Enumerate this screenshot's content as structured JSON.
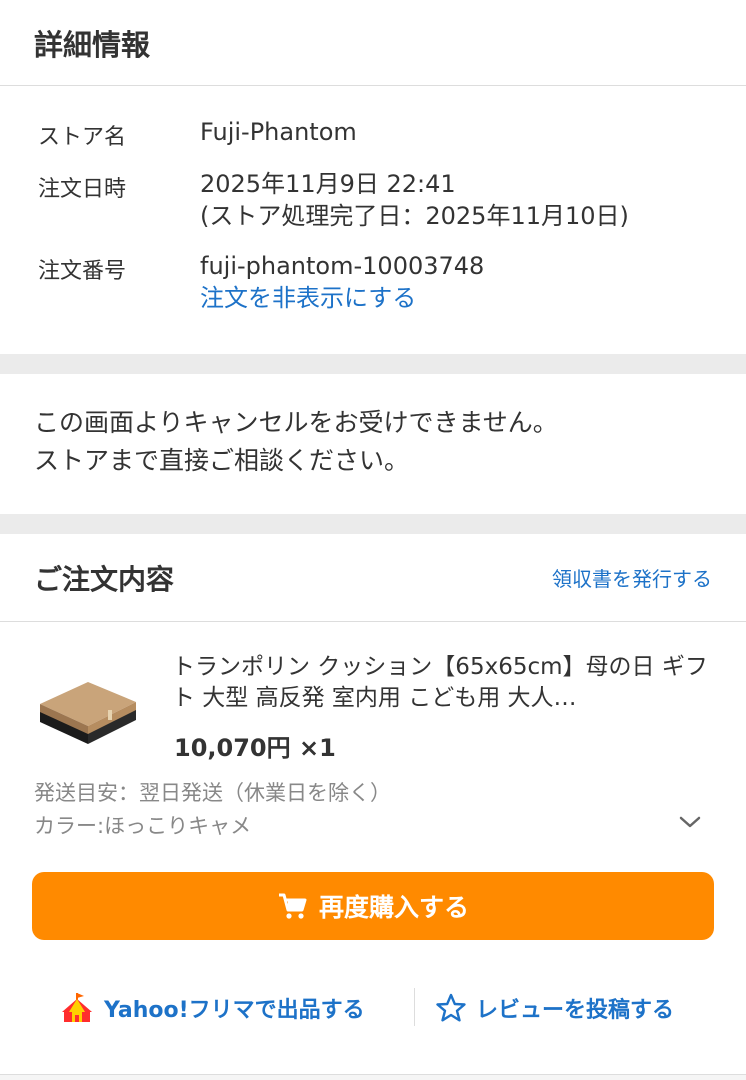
{
  "details": {
    "title": "詳細情報",
    "store_label": "ストア名",
    "store_name": "Fuji-Phantom",
    "date_label": "注文日時",
    "date_value": "2025年11月9日 22:41",
    "date_processed": "(ストア処理完了日：2025年11月10日)",
    "order_label": "注文番号",
    "order_number": "fuji-phantom-10003748",
    "hide_order_link": "注文を非表示にする"
  },
  "notice": {
    "line1": "この画面よりキャンセルをお受けできません。",
    "line2": "ストアまで直接ご相談ください。"
  },
  "order": {
    "title": "ご注文内容",
    "receipt_link": "領収書を発行する",
    "item": {
      "title": "トランポリン クッション【65x65cm】母の日 ギフト 大型 高反発 室内用 こども用 大人…",
      "price": "10,070円 ×1",
      "shipping": "発送目安：翌日発送（休業日を除く）",
      "color": "カラー:ほっこりキャメ",
      "image_icon": "product-cushion-image"
    },
    "buy_again_label": "再度購入する",
    "flea_label": "Yahoo!フリマで出品する",
    "review_label": "レビューを投稿する"
  },
  "colors": {
    "accent": "#ff8a00",
    "link": "#1d72c8",
    "divider": "#ebebeb"
  }
}
